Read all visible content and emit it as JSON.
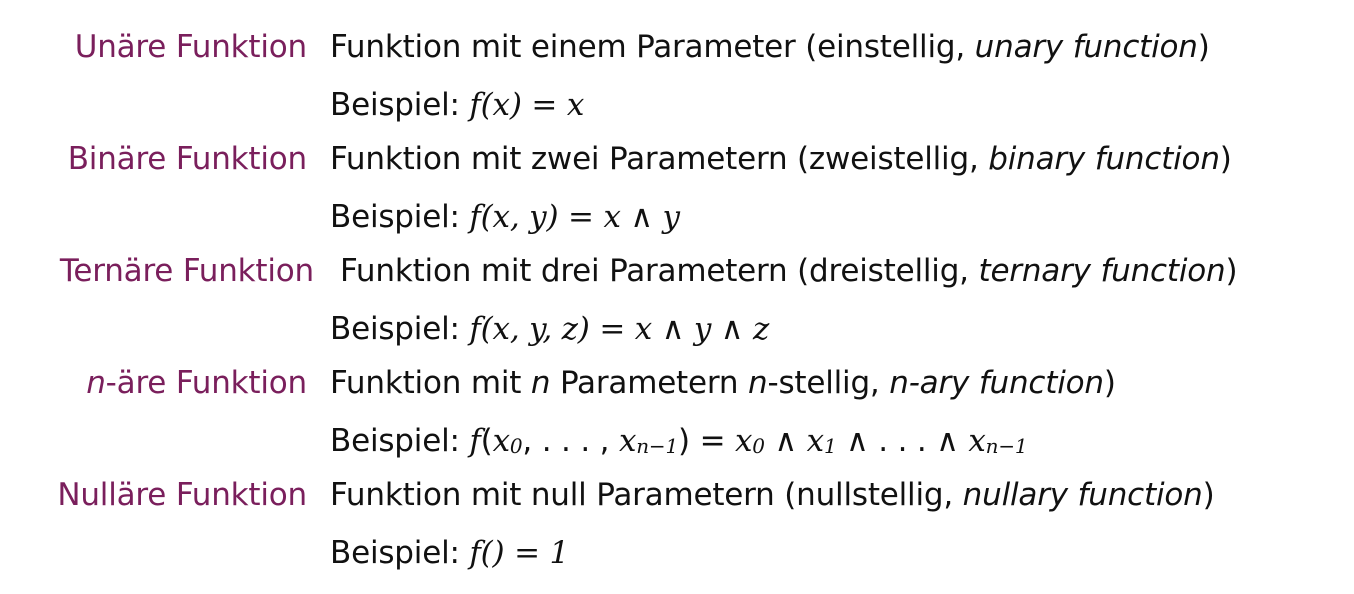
{
  "accent_color": "#7a1f5c",
  "entries": [
    {
      "term": "Unäre Funktion",
      "desc_text": "Funktion mit einem Parameter (einstellig, ",
      "desc_it": "unary function",
      "desc_end": ")",
      "example_label": "Beispiel:",
      "example_math": "f(x) = x"
    },
    {
      "term": "Binäre Funktion",
      "desc_text": "Funktion mit zwei Parametern (zweistellig, ",
      "desc_it": "binary function",
      "desc_end": ")",
      "example_label": "Beispiel:",
      "example_math": "f(x, y) = x ∧ y"
    },
    {
      "term": "Ternäre Funktion",
      "desc_text": "Funktion mit drei Parametern (dreistellig, ",
      "desc_it": "ternary function",
      "desc_end": ")",
      "example_label": "Beispiel:",
      "example_math": "f(x, y, z) = x ∧ y ∧ z"
    },
    {
      "term_n": "n",
      "term_rest": "-äre Funktion",
      "desc_a": "Funktion mit ",
      "desc_n1": "n",
      "desc_b": " Parametern ",
      "desc_n2": "n",
      "desc_c": "-stellig, ",
      "desc_it": "n-ary function",
      "desc_end": ")",
      "example_label": "Beispiel:",
      "example_f": "f",
      "example_open": "(",
      "x0": "x",
      "x0_sub": "0",
      "dots1": ", . . . , ",
      "xn1": "x",
      "xn1_sub": "n−1",
      "eq": ") = ",
      "rx0": "x",
      "rx0_sub": "0",
      "and1": " ∧ ",
      "rx1": "x",
      "rx1_sub": "1",
      "and2": " ∧ . . . ∧ ",
      "rxn": "x",
      "rxn_sub": "n−1"
    },
    {
      "term": "Nulläre Funktion",
      "desc_text": "Funktion mit null Parametern (nullstellig, ",
      "desc_it": "nullary function",
      "desc_end": ")",
      "example_label": "Beispiel:",
      "example_math": "f() = 1"
    }
  ]
}
